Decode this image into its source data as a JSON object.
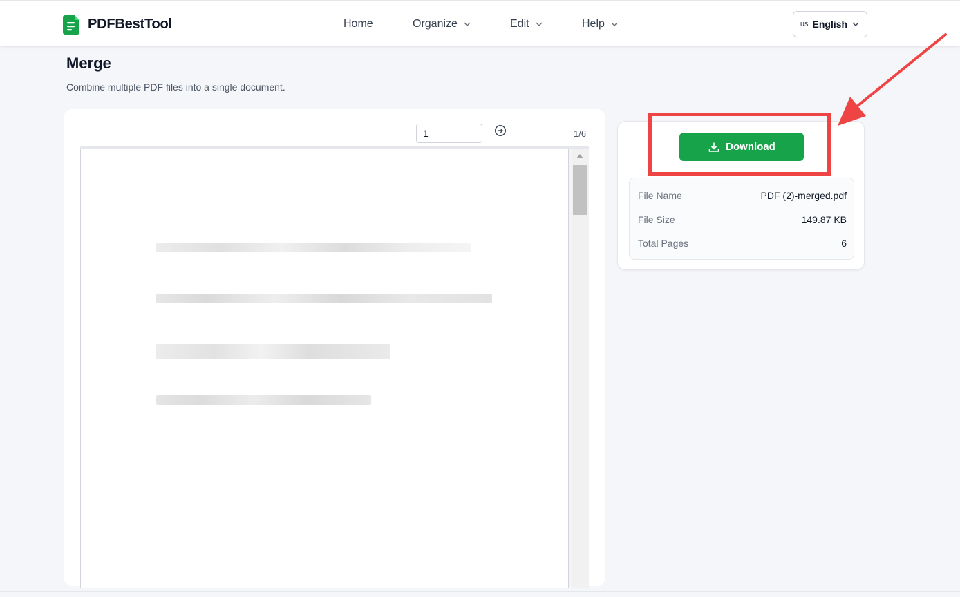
{
  "header": {
    "brand": "PDFBestTool",
    "nav": [
      {
        "label": "Home",
        "has_dropdown": false
      },
      {
        "label": "Organize",
        "has_dropdown": true
      },
      {
        "label": "Edit",
        "has_dropdown": true
      },
      {
        "label": "Help",
        "has_dropdown": true
      }
    ],
    "language": {
      "flag_code": "us",
      "label": "English"
    }
  },
  "page": {
    "title": "Merge",
    "subtitle": "Combine multiple PDF files into a single document."
  },
  "viewer": {
    "page_input_value": "1",
    "page_count": "1/6"
  },
  "result": {
    "download_label": "Download",
    "file_info": [
      {
        "key": "File Name",
        "value": "PDF (2)-merged.pdf"
      },
      {
        "key": "File Size",
        "value": "149.87 KB"
      },
      {
        "key": "Total Pages",
        "value": "6"
      }
    ]
  },
  "colors": {
    "brand_green": "#16a34a",
    "annotation_red": "#ef4444"
  },
  "icons": [
    "logo-icon",
    "chevron-down-icon",
    "arrow-right-circle-icon",
    "download-icon"
  ]
}
